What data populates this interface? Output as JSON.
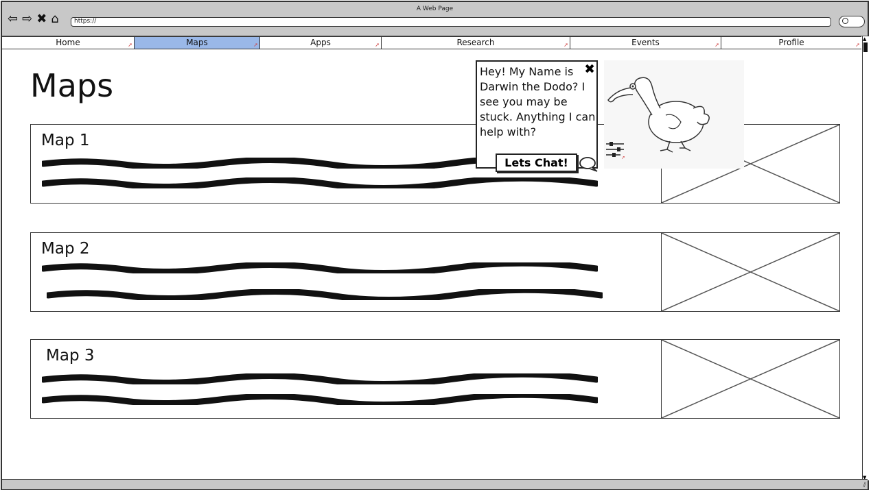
{
  "window": {
    "title": "A Web Page"
  },
  "browser": {
    "url": "https://",
    "nav": {
      "back": "⇦",
      "forward": "⇨",
      "stop": "✖",
      "home": "⌂"
    }
  },
  "tabs": [
    {
      "label": "Home"
    },
    {
      "label": "Maps",
      "active": true
    },
    {
      "label": "Apps"
    },
    {
      "label": "Research"
    },
    {
      "label": "Events"
    },
    {
      "label": "Profile"
    }
  ],
  "page": {
    "title": "Maps"
  },
  "cards": [
    {
      "name": "Map 1"
    },
    {
      "name": "Map 2"
    },
    {
      "name": "Map 3"
    }
  ],
  "assistant": {
    "message": "Hey! My Name is Darwin the Dodo? I see you may be stuck. Anything I can help with?",
    "close": "✖",
    "button": "Lets Chat!"
  },
  "colors": {
    "active_tab": "#9ab8e8",
    "chrome": "#c8c8c8"
  },
  "icons": [
    "back-arrow-icon",
    "forward-arrow-icon",
    "stop-icon",
    "home-icon",
    "search-icon",
    "close-icon",
    "chat-bubble-icon",
    "settings-sliders-icon",
    "dodo-mascot-image",
    "image-placeholder-icon"
  ]
}
